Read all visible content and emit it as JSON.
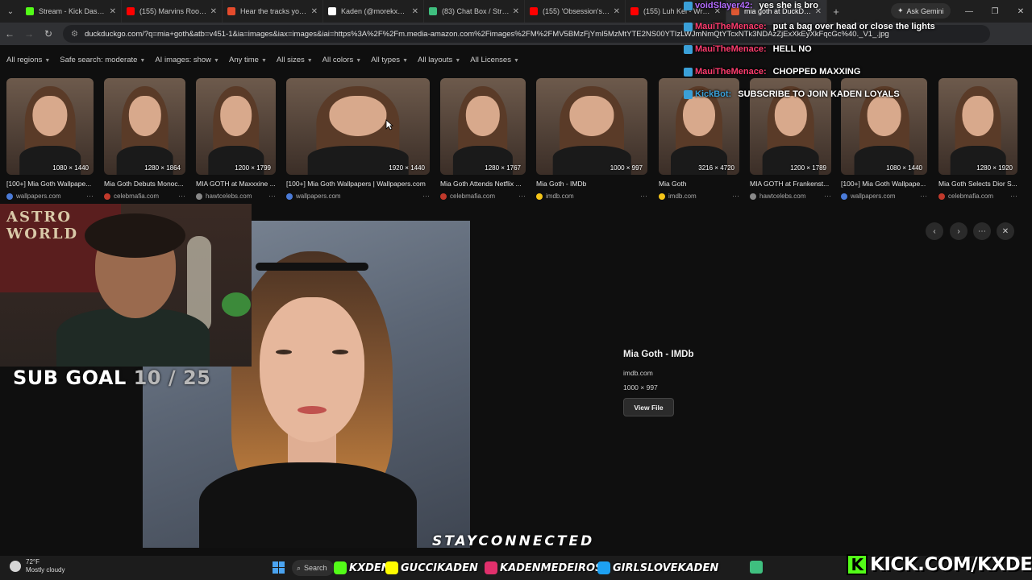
{
  "browser": {
    "tabs": [
      {
        "title": "Stream - Kick Dashboa",
        "color": "#53fc18",
        "active": false
      },
      {
        "title": "(155) Marvins Room -",
        "color": "#ff0000",
        "active": false
      },
      {
        "title": "Hear the tracks you've",
        "color": "#e54b2c",
        "active": false
      },
      {
        "title": "Kaden (@morekxden)",
        "color": "#ffffff",
        "active": false
      },
      {
        "title": "(83) Chat Box / Stream",
        "color": "#3fbf7f",
        "active": false
      },
      {
        "title": "(155) 'Obsession's Inde",
        "color": "#ff0000",
        "active": false
      },
      {
        "title": "(155) Luh Kel - Wrong",
        "color": "#ff0000",
        "active": false
      },
      {
        "title": "mia goth at DuckDuck",
        "color": "#de5833",
        "active": true
      }
    ],
    "new_tab": "+",
    "gemini_label": "Ask Gemini",
    "url": "duckduckgo.com/?q=mia+goth&atb=v451-1&ia=images&iax=images&iai=https%3A%2F%2Fm.media-amazon.com%2Fimages%2FM%2FMV5BMzFjYmI5MzMtYTE2NS00YTIzLWJmNmQtYTcxNTk3NDAzZjExXkEyXkFqcGc%40._V1_.jpg"
  },
  "filters": [
    "All regions",
    "Safe search: moderate",
    "AI images: show",
    "Any time",
    "All sizes",
    "All colors",
    "All types",
    "All layouts",
    "All Licenses"
  ],
  "results": [
    {
      "title": "[100+] Mia Goth Wallpape...",
      "source": "wallpapers.com",
      "dims": "1080 × 1440",
      "src_color": "#4a7bd8"
    },
    {
      "title": "Mia Goth Debuts Monoc...",
      "source": "celebmafia.com",
      "dims": "1280 × 1864",
      "src_color": "#c0392b"
    },
    {
      "title": "MIA GOTH at Maxxxine ...",
      "source": "hawtcelebs.com",
      "dims": "1200 × 1799",
      "src_color": "#888888"
    },
    {
      "title": "[100+] Mia Goth Wallpapers | Wallpapers.com",
      "source": "wallpapers.com",
      "dims": "1920 × 1440",
      "src_color": "#4a7bd8"
    },
    {
      "title": "Mia Goth Attends Netflix ...",
      "source": "celebmafia.com",
      "dims": "1280 × 1767",
      "src_color": "#c0392b"
    },
    {
      "title": "Mia Goth - IMDb",
      "source": "imdb.com",
      "dims": "1000 × 997",
      "src_color": "#f5c518"
    },
    {
      "title": "Mia Goth",
      "source": "imdb.com",
      "dims": "3216 × 4720",
      "src_color": "#f5c518"
    },
    {
      "title": "MIA GOTH at Frankenst...",
      "source": "hawtcelebs.com",
      "dims": "1200 × 1789",
      "src_color": "#888888"
    },
    {
      "title": "[100+] Mia Goth Wallpape...",
      "source": "wallpapers.com",
      "dims": "1080 × 1440",
      "src_color": "#4a7bd8"
    },
    {
      "title": "Mia Goth Selects Dior S...",
      "source": "celebmafia.com",
      "dims": "1280 × 1920",
      "src_color": "#c0392b"
    }
  ],
  "preview": {
    "title": "Mia Goth - IMDb",
    "domain": "imdb.com",
    "dims": "1000 × 997",
    "view_file": "View File"
  },
  "overlay": {
    "subgoal_label": "SUB GOAL",
    "subgoal_count": "10 / 25",
    "banner_text": "ASTRO WORLD",
    "stay_connected": "STAYCONNECTED",
    "kick_url": "KICK.COM/KXDEN"
  },
  "chat": [
    {
      "user": "voidSlayer42:",
      "msg": "yes she is bro",
      "color": "#b46cff"
    },
    {
      "user": "MauiTheMenace:",
      "msg": "put a bag over head or close the lights",
      "color": "#ff3c6e"
    },
    {
      "user": "MauiTheMenace:",
      "msg": "HELL NO",
      "color": "#ff3c6e"
    },
    {
      "user": "MauiTheMenace:",
      "msg": "CHOPPED MAXXING",
      "color": "#ff3c6e"
    },
    {
      "user": "KickBot:",
      "msg": "SUBSCRIBE TO JOIN KADEN LOYALS",
      "color": "#3aa0d8"
    }
  ],
  "socials": [
    {
      "handle": "KXDEN",
      "icon": "kick-icon",
      "color": "#53fc18"
    },
    {
      "handle": "GUCCIKADEN",
      "icon": "snapchat-icon",
      "color": "#fffc00"
    },
    {
      "handle": "KADENMEDEIROS",
      "icon": "instagram-icon",
      "color": "#e1306c"
    },
    {
      "handle": "GIRLSLOVEKADEN",
      "icon": "twitter-icon",
      "color": "#1da1f2"
    }
  ],
  "taskbar": {
    "temperature": "72°F",
    "weather": "Mostly cloudy",
    "search_label": "Search"
  }
}
